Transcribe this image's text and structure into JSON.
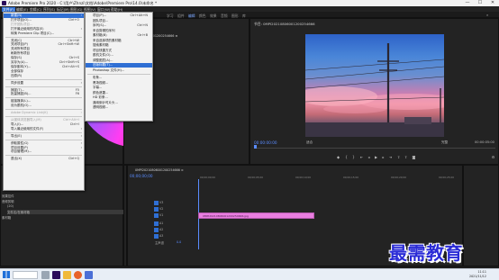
{
  "window": {
    "title": "Adobe Premiere Pro 2020 - C:\\用户\\Zhnzi\\文档\\Adobe\\Premiere Pro\\14.0\\未命名 *",
    "min": "—",
    "max": "☐",
    "close": "✕"
  },
  "menubar": [
    "文件(F)",
    "编辑(E)",
    "剪辑(C)",
    "序列(S)",
    "标记(M)",
    "图形(G)",
    "视图(V)",
    "窗口(W)",
    "帮助(H)"
  ],
  "workspaces": [
    "学习",
    "组件",
    "编辑",
    "颜色",
    "效果",
    "音频",
    "图形",
    "库"
  ],
  "file_menu": [
    {
      "label": "新建(N)",
      "sc": "",
      "hl": true,
      "arrow": true
    },
    {
      "label": "打开项目(O)...",
      "sc": "Ctrl+O"
    },
    {
      "label": "打开团队项目...",
      "sc": "",
      "dis": true
    },
    {
      "label": "打开最近使用的内容(E)",
      "sc": "",
      "arrow": true
    },
    {
      "label": "转换 Premiere Clip 项目(C)...",
      "sc": ""
    },
    {
      "sep": true
    },
    {
      "label": "关闭(C)",
      "sc": "Ctrl+W"
    },
    {
      "label": "关闭项目(P)",
      "sc": "Ctrl+Shift+W"
    },
    {
      "label": "关闭所有项目",
      "sc": ""
    },
    {
      "label": "刷新所有项目",
      "sc": ""
    },
    {
      "label": "保存(S)",
      "sc": "Ctrl+S"
    },
    {
      "label": "另存为(A)...",
      "sc": "Ctrl+Shift+S"
    },
    {
      "label": "保存副本(Y)...",
      "sc": "Ctrl+Alt+S"
    },
    {
      "label": "全部保存",
      "sc": ""
    },
    {
      "label": "还原(R)",
      "sc": ""
    },
    {
      "sep": true
    },
    {
      "label": "同步设置",
      "sc": "",
      "arrow": true
    },
    {
      "sep": true
    },
    {
      "label": "捕捉(T)...",
      "sc": "F5"
    },
    {
      "label": "批量捕捉(B)...",
      "sc": "F6"
    },
    {
      "sep": true
    },
    {
      "label": "链接媒体(L)...",
      "sc": ""
    },
    {
      "label": "设为脱机(O)...",
      "sc": ""
    },
    {
      "sep": true
    },
    {
      "label": "Adobe Dynamic Link(K)",
      "sc": "",
      "dis": true,
      "arrow": true
    },
    {
      "sep": true
    },
    {
      "label": "从媒体浏览器导入(M)",
      "sc": "Ctrl+Alt+I",
      "dis": true
    },
    {
      "label": "导入(I)...",
      "sc": "Ctrl+I"
    },
    {
      "label": "导入最近使用的文件(F)",
      "sc": "",
      "arrow": true
    },
    {
      "sep": true
    },
    {
      "label": "导出(E)",
      "sc": "",
      "arrow": true
    },
    {
      "sep": true
    },
    {
      "label": "获取属性(G)",
      "sc": "",
      "arrow": true
    },
    {
      "label": "项目设置(P)",
      "sc": "",
      "arrow": true
    },
    {
      "label": "项目管理(M)...",
      "sc": ""
    },
    {
      "sep": true
    },
    {
      "label": "退出(X)",
      "sc": "Ctrl+Q"
    }
  ],
  "new_submenu": [
    {
      "label": "项目(P)...",
      "sc": "Ctrl+Alt+N"
    },
    {
      "label": "团队项目...",
      "sc": ""
    },
    {
      "label": "序列(S)...",
      "sc": "Ctrl+N"
    },
    {
      "label": "来自剪辑的序列",
      "sc": ""
    },
    {
      "label": "素材箱(B)",
      "sc": "Ctrl+B"
    },
    {
      "label": "来自选择项的素材箱",
      "sc": ""
    },
    {
      "label": "搜索素材箱",
      "sc": ""
    },
    {
      "label": "项目快捷方式",
      "sc": ""
    },
    {
      "label": "脱机文件(O)...",
      "sc": ""
    },
    {
      "label": "调整图层(A)...",
      "sc": ""
    },
    {
      "label": "旧版标题(T)...",
      "sc": "",
      "hl": true
    },
    {
      "label": "Photoshop 文件(H)...",
      "sc": ""
    },
    {
      "sep": true
    },
    {
      "label": "彩条...",
      "sc": ""
    },
    {
      "label": "黑场视频...",
      "sc": ""
    },
    {
      "label": "字幕...",
      "sc": ""
    },
    {
      "label": "颜色遮罩...",
      "sc": ""
    },
    {
      "label": "HD 彩条...",
      "sc": ""
    },
    {
      "label": "通用倒计时片头...",
      "sc": ""
    },
    {
      "label": "透明视频...",
      "sc": ""
    }
  ],
  "program": {
    "tab": "节目: 0MPI20210806001200254666",
    "timecode": "00:00:00:00",
    "zoom": "适合",
    "quality": "完整",
    "duration": "00:00:05:00"
  },
  "source_tab": "00MPI20210806001200254666  ≡",
  "timeline": {
    "tab": "0MPI20210806001200254666 ≡",
    "timecode": "00;00;00;00",
    "clip_label": "0MPI20210806001200254666.jpg",
    "tracks": [
      "V3",
      "V2",
      "V1",
      "A1",
      "A2",
      "A3"
    ],
    "master": "主声道",
    "master_val": "0.0",
    "ruler": [
      "00;00;00;00",
      "00;00;05;00",
      "00;00;10;00",
      "00;00;15;00",
      "00;00;20;00",
      "00;00;25;00"
    ]
  },
  "project": {
    "rows": [
      "效果控件",
      "音频剪辑",
      "(20)",
      "文件名/在素材箱",
      "素材箱"
    ]
  },
  "taskbar": {
    "time": "11:11",
    "date": "2021/11/12"
  },
  "watermark": "最需教育",
  "colors": {
    "accent": "#2f6fd4",
    "clip": "#e97ee0",
    "timecode": "#5a8cff",
    "watermark": "#2a2bd6"
  }
}
